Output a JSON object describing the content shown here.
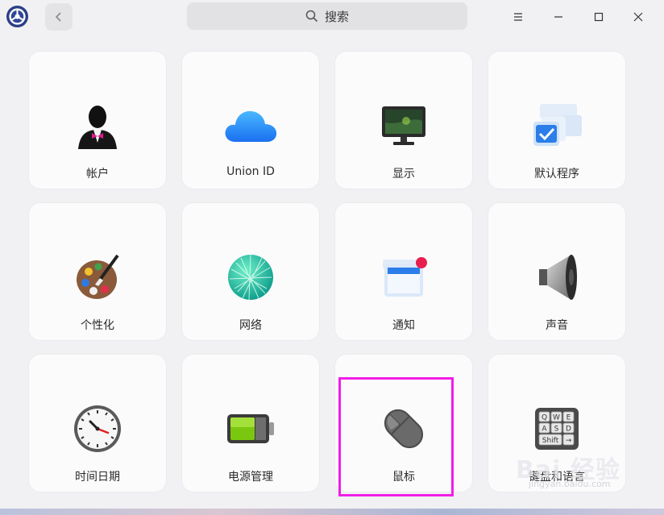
{
  "search": {
    "label": "搜索",
    "icon": "search-icon"
  },
  "items": [
    {
      "label": "帐户",
      "icon": "account-icon"
    },
    {
      "label": "Union ID",
      "icon": "cloud-icon"
    },
    {
      "label": "显示",
      "icon": "display-icon"
    },
    {
      "label": "默认程序",
      "icon": "default-apps-icon"
    },
    {
      "label": "个性化",
      "icon": "palette-icon"
    },
    {
      "label": "网络",
      "icon": "network-icon"
    },
    {
      "label": "通知",
      "icon": "notification-icon"
    },
    {
      "label": "声音",
      "icon": "speaker-icon"
    },
    {
      "label": "时间日期",
      "icon": "clock-icon"
    },
    {
      "label": "电源管理",
      "icon": "battery-icon"
    },
    {
      "label": "鼠标",
      "icon": "mouse-icon"
    },
    {
      "label": "键盘和语言",
      "icon": "keyboard-icon"
    }
  ],
  "keyboard_keys": [
    "Q",
    "W",
    "E",
    "A",
    "S",
    "D",
    "Shift",
    "→"
  ],
  "watermark": {
    "main": "Bai 经验",
    "sub": "jingyan.baidu.com"
  },
  "colors": {
    "highlight": "#f11ee7",
    "background": "#f1f1f3",
    "card": "#fbfbfc"
  }
}
